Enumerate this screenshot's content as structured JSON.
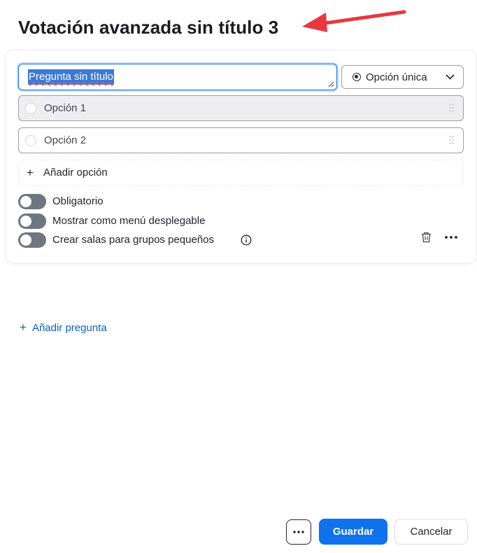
{
  "dialog": {
    "title": "Votación avanzada sin título 3"
  },
  "question": {
    "value": "Pregunta sin título",
    "type_label": "Opción única",
    "options": [
      {
        "label": "Opción 1"
      },
      {
        "label": "Opción 2"
      }
    ],
    "add_option_label": "Añadir opción",
    "toggles": {
      "required_label": "Obligatorio",
      "dropdown_label": "Mostrar como menú desplegable",
      "breakout_label": "Crear salas para grupos pequeños"
    }
  },
  "add_question_label": "Añadir pregunta",
  "footer": {
    "save_label": "Guardar",
    "cancel_label": "Cancelar"
  },
  "colors": {
    "accent": "#0e72ed",
    "toggle_off": "#6e7680",
    "annotation_arrow": "#e8373d"
  }
}
